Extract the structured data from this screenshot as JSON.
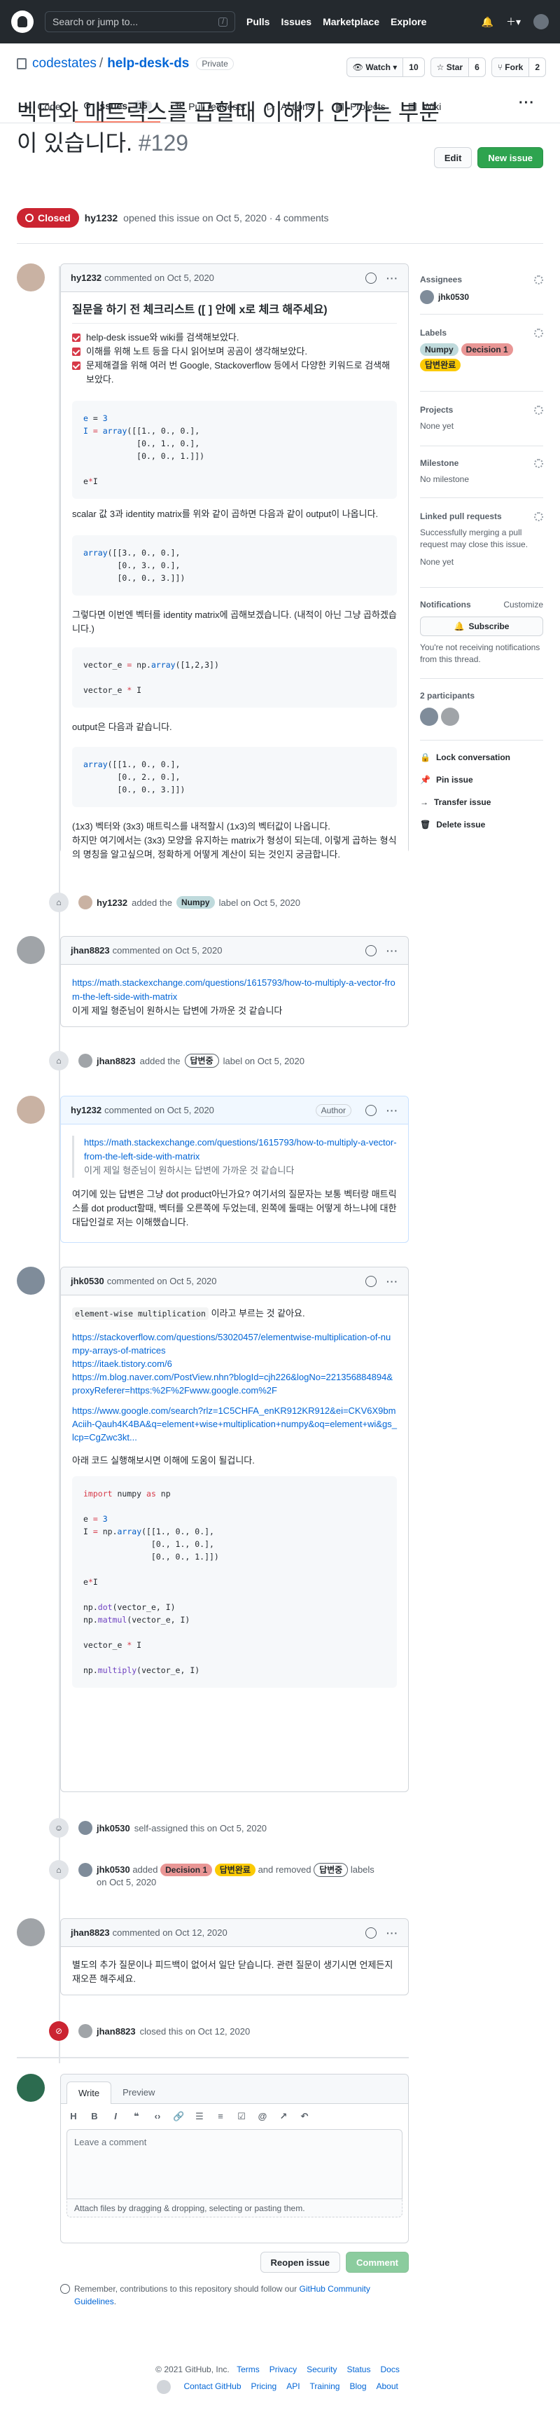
{
  "header": {
    "search_placeholder": "Search or jump to...",
    "slash": "/",
    "nav": [
      "Pulls",
      "Issues",
      "Marketplace",
      "Explore"
    ]
  },
  "repo": {
    "owner": "codestates",
    "slash": "/",
    "name": "help-desk-ds",
    "visibility": "Private",
    "watch": {
      "label": "Watch",
      "count": "10"
    },
    "star": {
      "label": "Star",
      "count": "6"
    },
    "fork": {
      "label": "Fork",
      "count": "2"
    },
    "tabs": [
      {
        "label": "Code",
        "icon": "code-icon"
      },
      {
        "label": "Issues",
        "count": "15",
        "icon": "issue-icon"
      },
      {
        "label": "Pull requests",
        "icon": "pr-icon"
      },
      {
        "label": "Actions",
        "icon": "play-icon"
      },
      {
        "label": "Projects",
        "icon": "project-icon"
      },
      {
        "label": "Wiki",
        "icon": "book-icon"
      }
    ]
  },
  "issue": {
    "title": "벡터와 매트릭스를 곱할때 이해가 안가는 부분이 있습니다.",
    "number": "#129",
    "status": "Closed",
    "author": "hy1232",
    "opened": "opened this issue on Oct 5, 2020 · 4 comments",
    "edit": "Edit",
    "new_issue": "New issue"
  },
  "c1": {
    "author": "hy1232",
    "when": "commented on Oct 5, 2020",
    "heading": "질문을 하기 전 체크리스트 ([ ] 안에 x로 체크 해주세요)",
    "checks": [
      "help-desk issue와 wiki를 검색해보았다.",
      "이해를 위해 노트 등을 다시 읽어보며 공곰이 생각해보았다.",
      "문제해결을 위해 여러 번 Google, Stackoverflow 등에서 다양한 키워드로 검색해보았다."
    ],
    "code1": [
      "e = 3",
      "I = array([[1., 0., 0.],",
      "           [0., 1., 0.],",
      "           [0., 0., 1.]])",
      "",
      "e*I"
    ],
    "p1": "scalar 값 3과 identity matrix를 위와 같이 곱하면 다음과 같이 output이 나옵니다.",
    "code2": [
      "array([[3., 0., 0.],",
      "       [0., 3., 0.],",
      "       [0., 0., 3.]])"
    ],
    "p2": "그렇다면 이번엔 벡터를 identity matrix에 곱해보겠습니다. (내적이 아닌 그냥 곱하겠습니다.)",
    "code3": [
      "vector_e = np.array([1,2,3])",
      "",
      "vector_e * I"
    ],
    "p3": "output은 다음과 같습니다.",
    "code4": [
      "array([[1., 0., 0.],",
      "       [0., 2., 0.],",
      "       [0., 0., 3.]])"
    ],
    "p4": "(1x3) 벡터와 (3x3) 매트릭스를 내적할시 (1x3)의 벡터값이 나옵니다.",
    "p5": "하지만 여기에서는 (3x3) 모양을 유지하는 matrix가 형성이 되는데, 이렇게 곱하는 형식의 명칭을 알고싶으며, 정확하게 어떻게 계산이 되는 것인지 궁금합니다."
  },
  "e1": {
    "actor": "hy1232",
    "pre": "added the",
    "label": "Numpy",
    "post": "label on Oct 5, 2020"
  },
  "c2": {
    "author": "jhan8823",
    "when": "commented on Oct 5, 2020",
    "link": "https://math.stackexchange.com/questions/1615793/how-to-multiply-a-vector-from-the-left-side-with-matrix",
    "text": "이게 제일 형준님이 원하시는 답변에 가까운 것 같습니다"
  },
  "e2": {
    "actor": "jhan8823",
    "pre": "added the",
    "label": "답변중",
    "post": "label on Oct 5, 2020"
  },
  "c3": {
    "author": "hy1232",
    "when": "commented on Oct 5, 2020",
    "badge": "Author",
    "quote_link": "https://math.stackexchange.com/questions/1615793/how-to-multiply-a-vector-from-the-left-side-with-matrix",
    "quote_text": "이게 제일 형준님이 원하시는 답변에 가까운 것 같습니다",
    "text": "여기에 있는 답변은 그냥 dot product아닌가요? 여기서의 질문자는 보통 벡터랑 매트릭스를 dot product할때, 벡터를 오른쪽에 두었는데, 왼쪽에 둘때는 어떻게 하느냐에 대한 대답인걸로 저는 이해했습니다."
  },
  "c4": {
    "author": "jhk0530",
    "when": "commented on Oct 5, 2020",
    "code_inline": "element-wise multiplication",
    "intro": "이라고 부르는 것 같아요.",
    "links": [
      "https://stackoverflow.com/questions/53020457/elementwise-multiplication-of-numpy-arrays-of-matrices",
      "https://itaek.tistory.com/6",
      "https://m.blog.naver.com/PostView.nhn?blogId=cjh226&logNo=221356884894&proxyReferer=https:%2F%2Fwww.google.com%2F",
      "https://www.google.com/search?rlz=1C5CHFA_enKR912KR912&ei=CKV6X9bmAciih-Qauh4K4BA&q=element+wise+multiplication+numpy&oq=element+wi&gs_lcp=CgZwc3kt..."
    ],
    "outro": "아래 코드 실행해보시면 이해에 도움이 될겁니다.",
    "code": [
      "import numpy as np",
      "",
      "e = 3",
      "I = np.array([[1., 0., 0.],",
      "              [0., 1., 0.],",
      "              [0., 0., 1.]])",
      "",
      "e*I",
      "",
      "np.dot(vector_e, I)",
      "np.matmul(vector_e, I)",
      "",
      "vector_e * I",
      "",
      "np.multiply(vector_e, I)"
    ]
  },
  "e3": {
    "actor": "jhk0530",
    "text": "self-assigned this on Oct 5, 2020"
  },
  "e4": {
    "actor": "jhk0530",
    "pre": "added",
    "label1": "Decision 1",
    "label2": "답변완료",
    "mid": "and removed",
    "label3": "답변중",
    "post": "labels",
    "date": "on Oct 5, 2020"
  },
  "c5": {
    "author": "jhan8823",
    "when": "commented on Oct 12, 2020",
    "text": "별도의 추가 질문이나 피드백이 없어서 일단 닫습니다. 관련 질문이 생기시면 언제든지 재오픈 해주세요."
  },
  "e5": {
    "actor": "jhan8823",
    "text": "closed this on Oct 12, 2020"
  },
  "editor": {
    "write": "Write",
    "preview": "Preview",
    "placeholder": "Leave a comment",
    "attach": "Attach files by dragging & dropping, selecting or pasting them.",
    "reopen": "Reopen issue",
    "comment": "Comment",
    "note_pre": "Remember, contributions to this repository should follow our",
    "note_link": "GitHub Community Guidelines",
    "note_post": "."
  },
  "sidebar": {
    "assignees_h": "Assignees",
    "assignee": "jhk0530",
    "labels_h": "Labels",
    "labels": [
      {
        "name": "Numpy",
        "color": "#bfdadc"
      },
      {
        "name": "Decision 1",
        "color": "#e99695"
      },
      {
        "name": "답변완료",
        "color": "#fbca04"
      }
    ],
    "projects_h": "Projects",
    "projects_v": "None yet",
    "milestone_h": "Milestone",
    "milestone_v": "No milestone",
    "linked_h": "Linked pull requests",
    "linked_desc": "Successfully merging a pull request may close this issue.",
    "linked_v": "None yet",
    "notif_h": "Notifications",
    "customize": "Customize",
    "subscribe": "Subscribe",
    "notif_desc": "You're not receiving notifications from this thread.",
    "participants_h": "2 participants",
    "actions": [
      {
        "label": "Lock conversation",
        "icon": "lock-icon"
      },
      {
        "label": "Pin issue",
        "icon": "pin-icon"
      },
      {
        "label": "Transfer issue",
        "icon": "arrow-right-icon"
      },
      {
        "label": "Delete issue",
        "icon": "trash-icon"
      }
    ]
  },
  "footer": {
    "copy": "© 2021 GitHub, Inc.",
    "links1": [
      "Terms",
      "Privacy",
      "Security",
      "Status",
      "Docs"
    ],
    "links2": [
      "Contact GitHub",
      "Pricing",
      "API",
      "Training",
      "Blog",
      "About"
    ]
  }
}
